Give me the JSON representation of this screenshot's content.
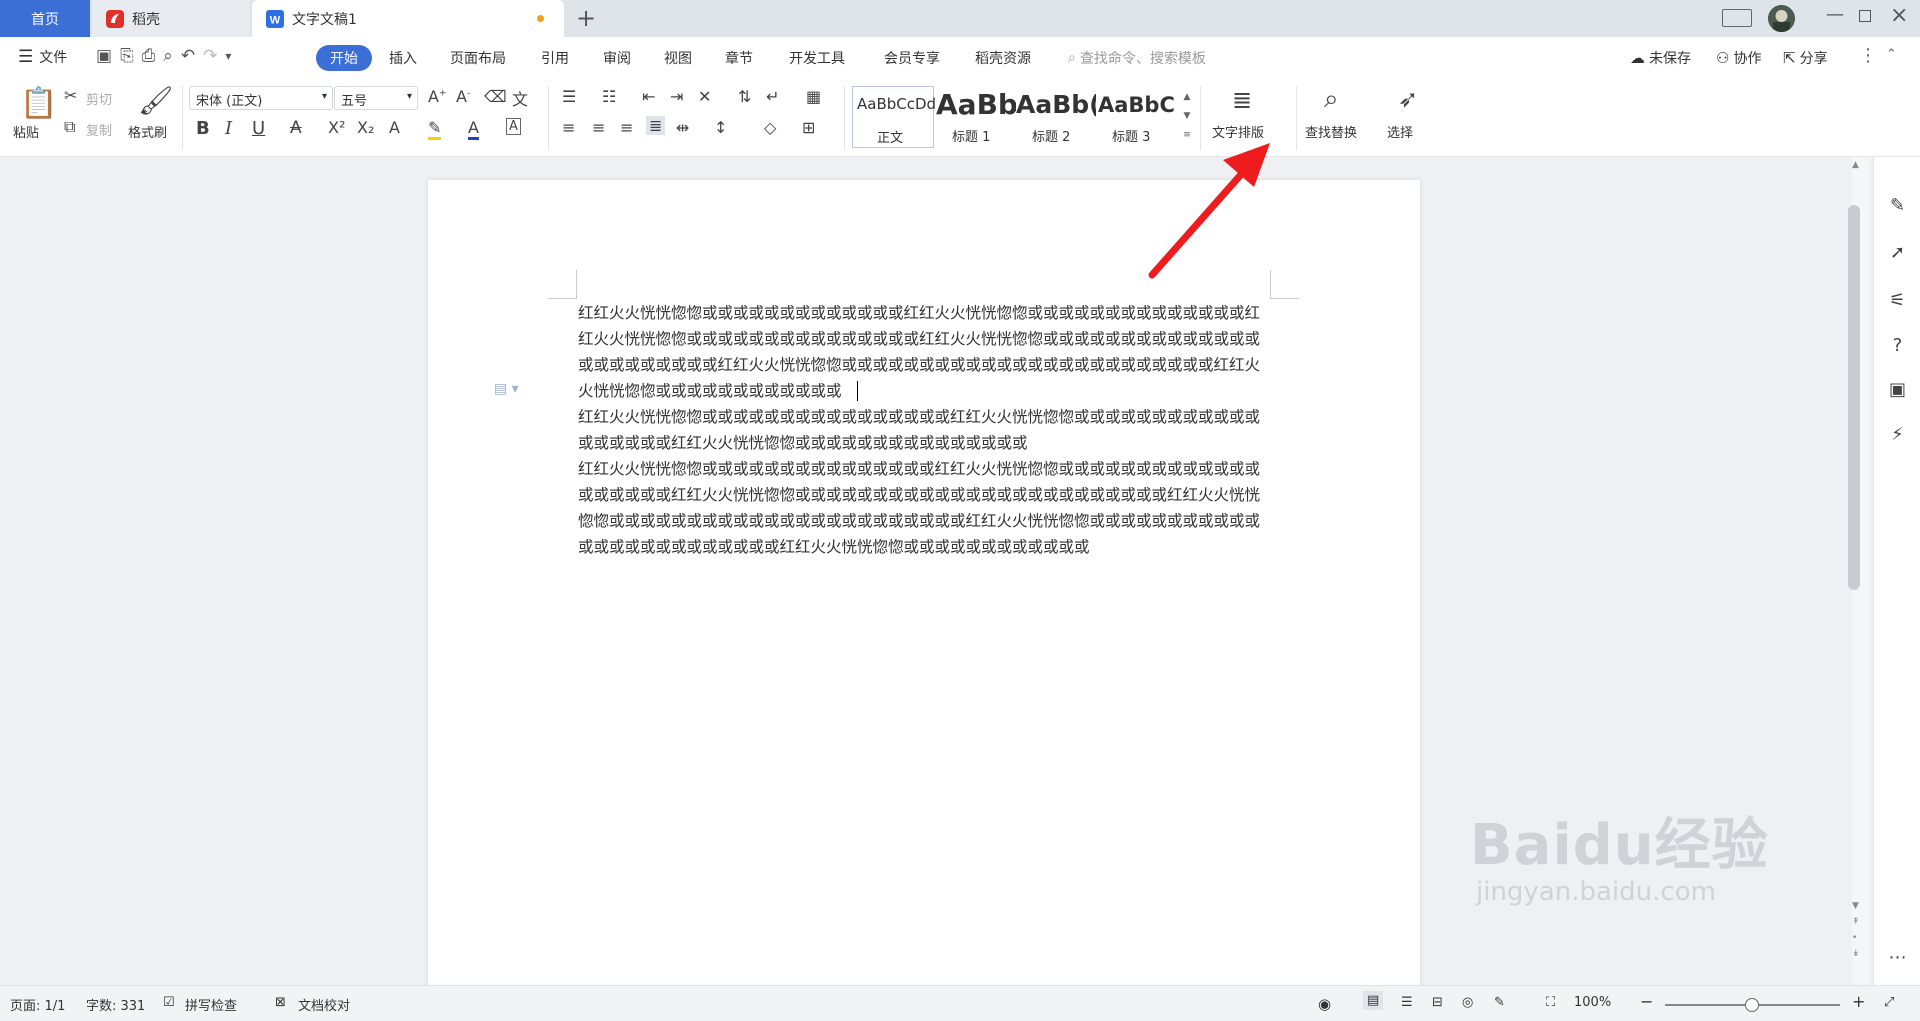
{
  "tabs": {
    "home": "首页",
    "daoke": "稻壳",
    "doc": "文字文稿1",
    "add": "+"
  },
  "menu": {
    "file": "文件",
    "items": [
      "开始",
      "插入",
      "页面布局",
      "引用",
      "审阅",
      "视图",
      "章节",
      "开发工具",
      "会员专享",
      "稻壳资源"
    ],
    "search_placeholder": "查找命令、搜索模板",
    "unsaved": "未保存",
    "collab": "协作",
    "share": "分享"
  },
  "ribbon": {
    "paste": "粘贴",
    "cut": "剪切",
    "copy": "复制",
    "format_painter": "格式刷",
    "font": "宋体 (正文)",
    "size": "五号",
    "styles": [
      {
        "sample": "AaBbCcDd",
        "name": "正文"
      },
      {
        "sample": "AaBb",
        "name": "标题 1"
      },
      {
        "sample": "AaBb(",
        "name": "标题 2"
      },
      {
        "sample": "AaBbC(",
        "name": "标题 3"
      }
    ],
    "text_layout": "文字排版",
    "find_replace": "查找替换",
    "select": "选择"
  },
  "document": {
    "paragraphs": [
      "红红火火恍恍惚惚或或或或或或或或或或或或或红红火火恍恍惚惚或或或或或或或或或或或或或或红红火火恍恍惚惚或或或或或或或或或或或或或或或红红火火恍恍惚惚或或或或或或或或或或或或或或或或或或或或或或或红红火火恍恍惚惚或或或或或或或或或或或或或或或或或或或或或或或或红红火火恍恍惚惚或或或或或或或或或或或或",
      "红红火火恍恍惚惚或或或或或或或或或或或或或或或或红红火火恍恍惚惚或或或或或或或或或或或或或或或或或或红红火火恍恍惚惚或或或或或或或或或或或或或或或",
      "红红火火恍恍惚惚或或或或或或或或或或或或或或或红红火火恍恍惚惚或或或或或或或或或或或或或或或或或或或红红火火恍恍惚惚或或或或或或或或或或或或或或或或或或或或或或或或红红火火恍恍惚惚或或或或或或或或或或或或或或或或或或或或或或或红红火火恍恍惚惚或或或或或或或或或或或或或或或或或或或或或或或或红红火火恍恍惚惚或或或或或或或或或或或或"
    ]
  },
  "status": {
    "page": "页面: 1/1",
    "words": "字数: 331",
    "spell": "拼写检查",
    "proof": "文档校对",
    "zoom": "100%"
  },
  "watermark": {
    "logo": "Baidu经验",
    "url": "jingyan.baidu.com"
  },
  "colors": {
    "accent": "#3b6fd6",
    "arrow": "#ee1c1c"
  }
}
